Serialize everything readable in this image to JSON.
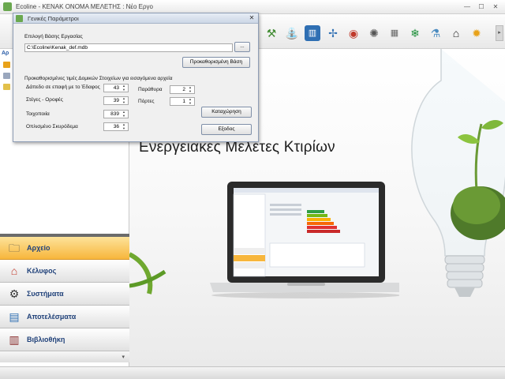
{
  "app": {
    "title": "Ecoline - KENAK    ΟΝΟΜΑ ΜΕΛΕΤΗΣ : Νέο Εργο"
  },
  "window_controls": {
    "minimize": "—",
    "maximize": "☐",
    "close": "✕"
  },
  "toolbar": {
    "icons": [
      "hammer-plant-icon",
      "faucet-icon",
      "window-icon",
      "wind-turbine-icon",
      "gauge-icon",
      "compass-icon",
      "radiator-icon",
      "snowflake-icon",
      "pipe-icon",
      "roof-icon",
      "lightbulb-icon"
    ],
    "colors": {
      "green": "#3e8a2f",
      "orange": "#e8a21a",
      "blue": "#2f6fb3",
      "red": "#c0392b"
    }
  },
  "nav": {
    "items": [
      {
        "label": "Αρχείο",
        "active": true
      },
      {
        "label": "Κέλυφος",
        "active": false
      },
      {
        "label": "Συστήματα",
        "active": false
      },
      {
        "label": "Αποτελέσματα",
        "active": false
      },
      {
        "label": "Βιβλιοθήκη",
        "active": false
      }
    ],
    "active_color": "#f7b63c"
  },
  "content": {
    "heading": "Ενεργειακές Μελέτες Κτιρίων"
  },
  "dialog": {
    "title": "Γενικές Παράμετροι",
    "db_label": "Επιλογή Βάσης Εργασίας",
    "db_path": "C:\\Ecoline\\Kenak_def.mdb",
    "browse_label": "...",
    "default_db_button": "Προκαθορισμένη Βάση",
    "section_label": "Προκαθορισμένες τιμές Δομικών Στοιχείων για εισαγόμενα αρχεία",
    "fields": {
      "floor_label": "Δάπεδο σε επαφή με το Έδαφος",
      "floor_value": "43",
      "roof_label": "Στέγες - Οροφές",
      "roof_value": "39",
      "masonry_label": "Τοιχοποιία",
      "masonry_value": "839",
      "concrete_label": "Οπλισμένο Σκυρόδεμα",
      "concrete_value": "36",
      "window_label": "Παράθυρα",
      "window_value": "2",
      "door_label": "Πόρτες",
      "door_value": "1"
    },
    "save_button": "Καταχώρηση",
    "exit_button": "Εξοδος"
  }
}
